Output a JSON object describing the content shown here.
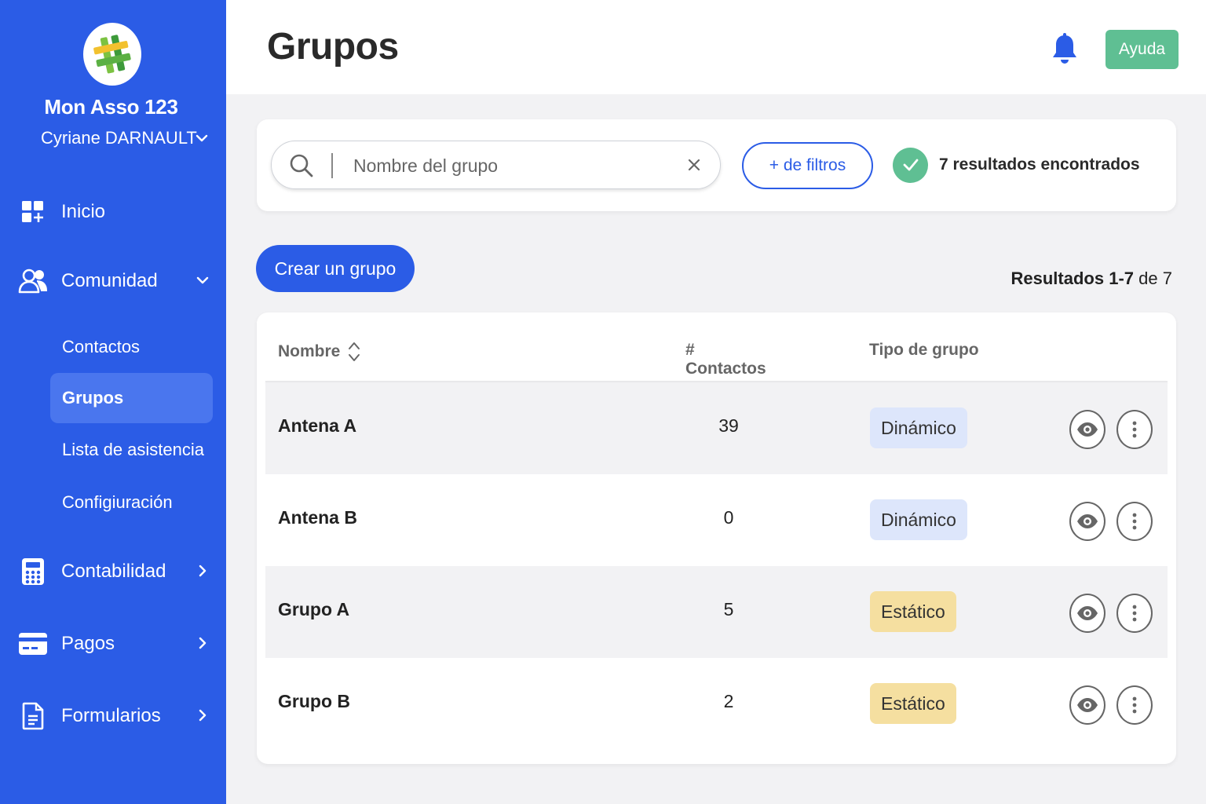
{
  "sidebar": {
    "org_name": "Mon Asso 123",
    "user_name": "Cyriane DARNAULT",
    "nav": {
      "inicio": "Inicio",
      "comunidad": "Comunidad",
      "contabilidad": "Contabilidad",
      "pagos": "Pagos",
      "formularios": "Formularios"
    },
    "sub": {
      "contactos": "Contactos",
      "grupos": "Grupos",
      "lista": "Lista de asistencia",
      "config": "Configiuración"
    },
    "accent": "#2b5ce6"
  },
  "header": {
    "title": "Grupos",
    "help_label": "Ayuda"
  },
  "search": {
    "placeholder": "Nombre del grupo",
    "value": "",
    "filters_label": "+ de filtros",
    "results_text": "7 resultados encontrados"
  },
  "actions": {
    "create_label": "Crear un grupo"
  },
  "pagination": {
    "prefix": "Resultados",
    "range": "1-7",
    "of": "de",
    "total": "7"
  },
  "table": {
    "columns": {
      "name": "Nombre",
      "contacts": "# Contactos",
      "type": "Tipo de grupo"
    },
    "rows": [
      {
        "name": "Antena A",
        "contacts": "39",
        "type": "Dinámico"
      },
      {
        "name": "Antena B",
        "contacts": "0",
        "type": "Dinámico"
      },
      {
        "name": "Grupo A",
        "contacts": "5",
        "type": "Estático"
      },
      {
        "name": "Grupo B",
        "contacts": "2",
        "type": "Estático"
      }
    ]
  },
  "colors": {
    "brand": "#2b5ce6",
    "success": "#5fbf93",
    "dynamic_badge": "#dde6fb",
    "static_badge": "#f5dfa0"
  }
}
